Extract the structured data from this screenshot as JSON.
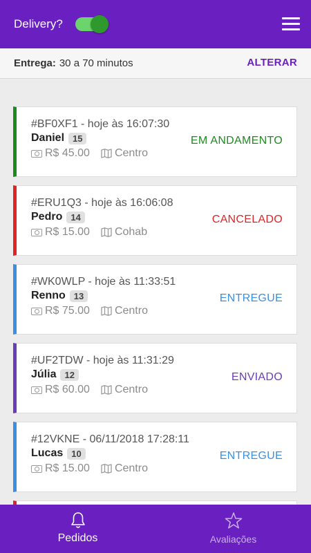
{
  "header": {
    "title": "Delivery?",
    "toggle_on": true,
    "menu_icon": "hamburger-menu-icon"
  },
  "delivery": {
    "label": "Entrega:",
    "value": "30 a 70 minutos",
    "change_label": "ALTERAR"
  },
  "orders": [
    {
      "code": "#BF0XF1 - hoje às 16:07:30",
      "name": "Daniel",
      "count": "15",
      "price": "R$ 45.00",
      "neighborhood": "Centro",
      "status": "EM ANDAMENTO",
      "color": "#1e8a1e"
    },
    {
      "code": "#ERU1Q3 - hoje às 16:06:08",
      "name": "Pedro",
      "count": "14",
      "price": "R$ 15.00",
      "neighborhood": "Cohab",
      "status": "CANCELADO",
      "color": "#e02424"
    },
    {
      "code": "#WK0WLP - hoje às 11:33:51",
      "name": "Renno",
      "count": "13",
      "price": "R$ 75.00",
      "neighborhood": "Centro",
      "status": "ENTREGUE",
      "color": "#3b8fe0"
    },
    {
      "code": "#UF2TDW - hoje às 11:31:29",
      "name": "Júlia",
      "count": "12",
      "price": "R$ 60.00",
      "neighborhood": "Centro",
      "status": "ENVIADO",
      "color": "#6a3db8"
    },
    {
      "code": "#12VKNE - 06/11/2018 17:28:11",
      "name": "Lucas",
      "count": "10",
      "price": "R$ 15.00",
      "neighborhood": "Centro",
      "status": "ENTREGUE",
      "color": "#3b8fe0"
    }
  ],
  "partial_card_color": "#e02424",
  "nav": {
    "orders_label": "Pedidos",
    "reviews_label": "Avaliações"
  },
  "colors": {
    "primary": "#6a1fc0"
  }
}
